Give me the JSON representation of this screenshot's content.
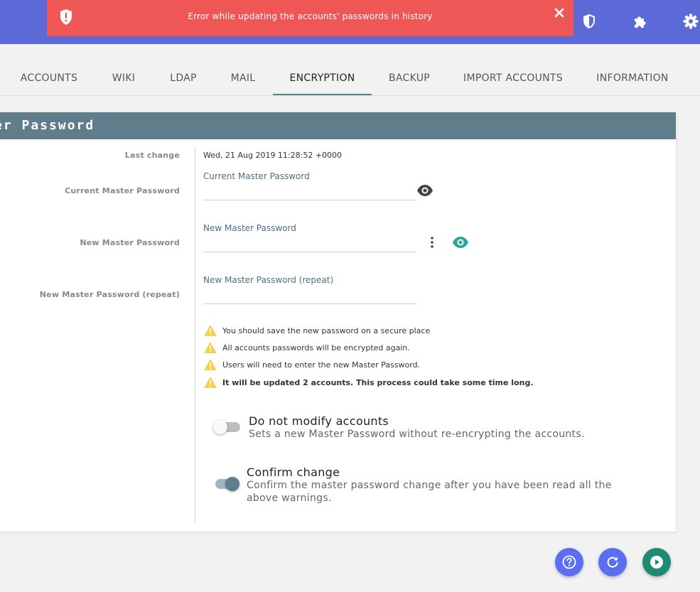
{
  "colors": {
    "topbar": "#5c6ad8",
    "error": "#ef5656",
    "card_header": "#607d8b",
    "accent_teal": "#26a69a",
    "fab_indigo": "#5c6ef0",
    "fab_teal": "#1e8a72"
  },
  "error_toast": {
    "icon": "shield-alert-icon",
    "message": "Error while updating the accounts' passwords in history",
    "close_icon": "close-icon"
  },
  "top_icons": [
    "shield-icon",
    "puzzle-icon",
    "gear-icon"
  ],
  "tabs": [
    {
      "label": "ACCOUNTS",
      "active": false
    },
    {
      "label": "WIKI",
      "active": false
    },
    {
      "label": "LDAP",
      "active": false
    },
    {
      "label": "MAIL",
      "active": false
    },
    {
      "label": "ENCRYPTION",
      "active": true
    },
    {
      "label": "BACKUP",
      "active": false
    },
    {
      "label": "IMPORT ACCOUNTS",
      "active": false
    },
    {
      "label": "INFORMATION",
      "active": false
    }
  ],
  "card": {
    "title": "er Password",
    "last_change_label": "Last change",
    "last_change_value": "Wed, 21 Aug 2019 11:28:52 +0000",
    "current": {
      "label": "Current Master Password",
      "field_label": "Current Master Password",
      "value": ""
    },
    "new": {
      "label": "New Master Password",
      "field_label": "New Master Password",
      "value": ""
    },
    "repeat": {
      "label": "New Master Password (repeat)",
      "field_label": "New Master Password (repeat)",
      "value": ""
    },
    "warnings": [
      {
        "text": "You should save the new password on a secure place",
        "bold": false
      },
      {
        "text": "All accounts passwords will be encrypted again.",
        "bold": false
      },
      {
        "text": "Users will need to enter the new Master Password.",
        "bold": false
      },
      {
        "text": "It will be updated 2 accounts. This process could take some time long.",
        "bold": true
      }
    ],
    "toggles": {
      "no_modify": {
        "title": "Do not modify accounts",
        "desc": "Sets a new Master Password without re-encrypting the accounts.",
        "on": false
      },
      "confirm": {
        "title": "Confirm change",
        "desc": "Confirm the master password change after you have been read all the above warnings.",
        "on": true
      }
    }
  },
  "fabs": [
    "help-icon",
    "refresh-icon",
    "play-icon"
  ]
}
